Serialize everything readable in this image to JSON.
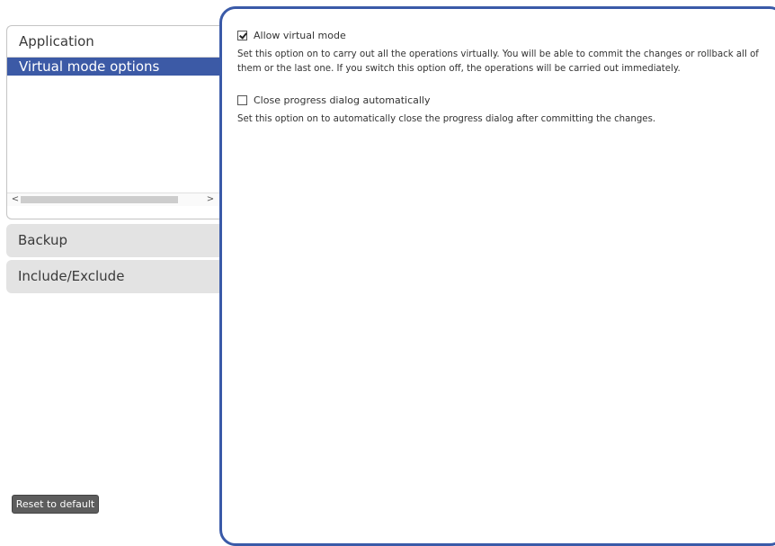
{
  "sidebar": {
    "active_section": {
      "label": "Application",
      "items": [
        {
          "label": "Virtual mode options",
          "selected": true
        }
      ],
      "scrollbar": {
        "left_arrow": "<",
        "right_arrow": ">"
      }
    },
    "collapsed_sections": [
      {
        "label": "Backup"
      },
      {
        "label": "Include/Exclude"
      }
    ],
    "reset_label": "Reset to default"
  },
  "main": {
    "options": [
      {
        "label": "Allow virtual mode",
        "checked": true,
        "description": "Set this option on to carry out all the operations virtually. You will be able to commit the changes or rollback all of them or the last one. If you switch this option off, the operations will be carried out immediately."
      },
      {
        "label": "Close progress dialog automatically",
        "checked": false,
        "description": "Set this option on to automatically close the progress dialog after committing the changes."
      }
    ]
  },
  "colors": {
    "accent": "#3c5aa6",
    "panel_border": "#3a5aa8",
    "collapsed_bg": "#e3e3e3",
    "button_bg": "#5d5d5d"
  }
}
